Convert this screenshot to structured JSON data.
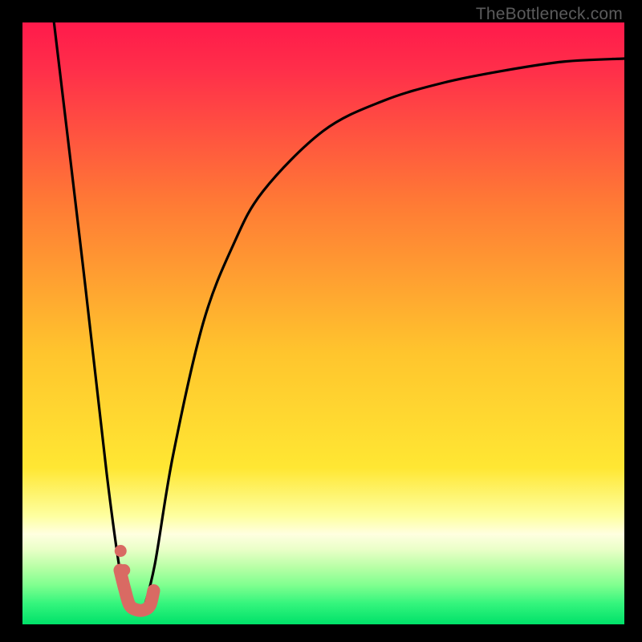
{
  "watermark": "TheBottleneck.com",
  "colors": {
    "black": "#000000",
    "red_top": "#ff1a4b",
    "orange": "#ff9a2c",
    "yellow": "#ffe733",
    "pale_yellow": "#feff9f",
    "light_green": "#c9ffad",
    "green": "#00e66a",
    "curve": "#000000",
    "marker_stroke": "#d96a63",
    "marker_fill": "#d96a63"
  },
  "chart_data": {
    "type": "line",
    "title": "",
    "xlabel": "",
    "ylabel": "",
    "xlim": [
      0,
      100
    ],
    "ylim": [
      0,
      100
    ],
    "note": "Axes unlabeled; values estimated from pixel positions on a 0–100 normalized grid. y=0 at bottom (green band), y=100 at top (red).",
    "series": [
      {
        "name": "left-descending-branch",
        "x": [
          5,
          10,
          14,
          16.5,
          18
        ],
        "y": [
          102,
          60,
          25,
          7,
          2
        ],
        "style": "line"
      },
      {
        "name": "right-rising-branch",
        "x": [
          20,
          22,
          25,
          30,
          35,
          40,
          50,
          60,
          70,
          80,
          90,
          100
        ],
        "y": [
          2,
          10,
          28,
          50,
          63,
          72,
          82,
          87,
          90,
          92,
          93.5,
          94
        ],
        "style": "line"
      },
      {
        "name": "marker-valley",
        "x": [
          16.2,
          17,
          17.8,
          19.0,
          20.2,
          21.2,
          21.8
        ],
        "y": [
          9,
          5.8,
          3.2,
          2.4,
          2.4,
          3.2,
          5.6
        ],
        "style": "thick-rounded"
      },
      {
        "name": "marker-dots",
        "x": [
          16.3,
          16.9
        ],
        "y": [
          12.2,
          9.0
        ],
        "style": "dots"
      }
    ],
    "gradient_stops": [
      {
        "pos": 0.0,
        "color": "#ff1a4b"
      },
      {
        "pos": 0.08,
        "color": "#ff2f4a"
      },
      {
        "pos": 0.3,
        "color": "#ff7a35"
      },
      {
        "pos": 0.55,
        "color": "#ffc52d"
      },
      {
        "pos": 0.74,
        "color": "#ffe733"
      },
      {
        "pos": 0.82,
        "color": "#feffa0"
      },
      {
        "pos": 0.85,
        "color": "#ffffe0"
      },
      {
        "pos": 0.875,
        "color": "#eaffc8"
      },
      {
        "pos": 0.905,
        "color": "#b8ffa6"
      },
      {
        "pos": 0.935,
        "color": "#7fff8f"
      },
      {
        "pos": 0.965,
        "color": "#35f57d"
      },
      {
        "pos": 1.0,
        "color": "#00e169"
      }
    ]
  }
}
